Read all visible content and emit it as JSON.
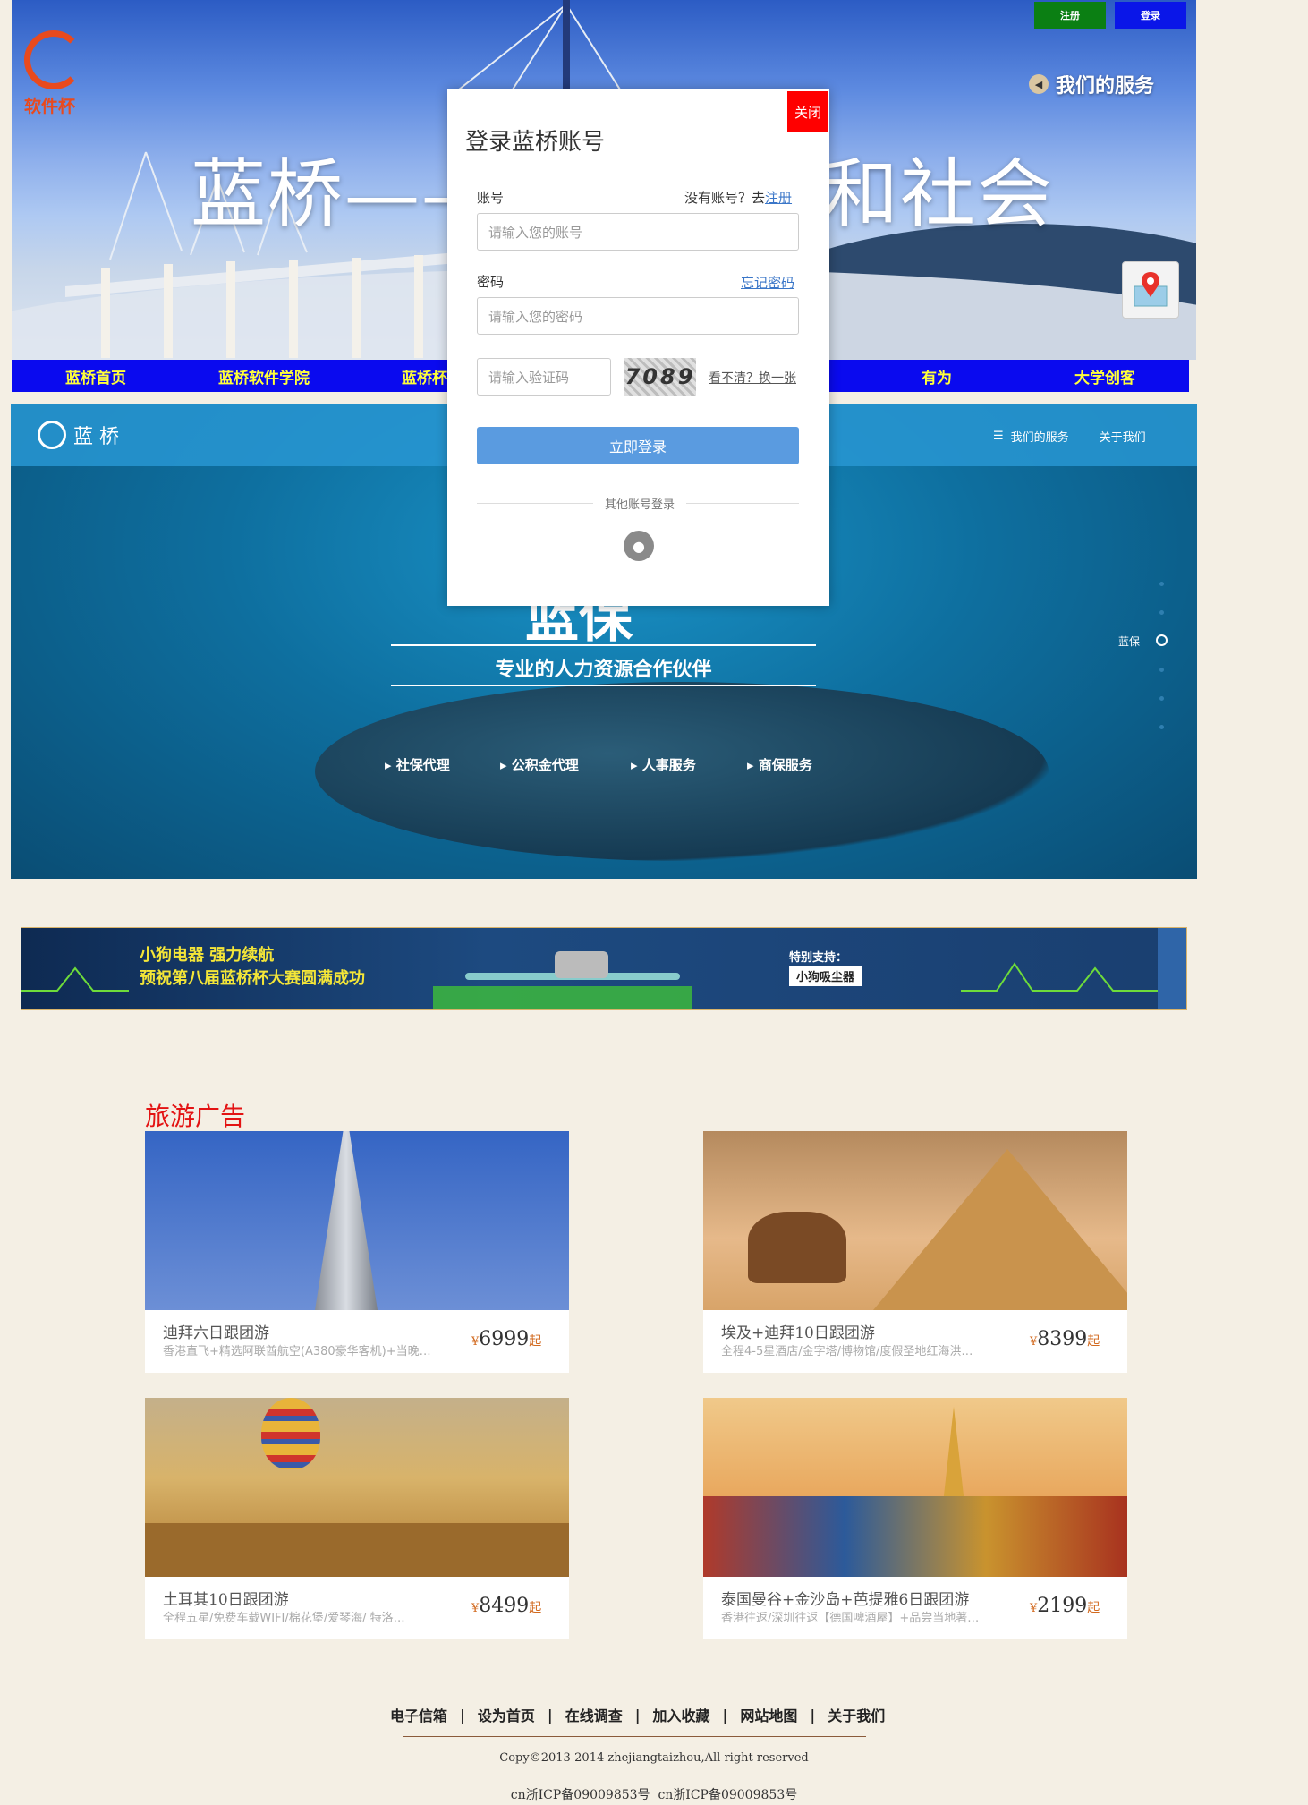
{
  "header": {
    "logo_text": "软件杯",
    "register_label": "注册",
    "login_label": "登录",
    "services_link": "我们的服务",
    "hero_title_left": "蓝桥——",
    "hero_title_right": "和社会"
  },
  "nav": {
    "items": [
      {
        "label": "蓝桥首页"
      },
      {
        "label": "蓝桥软件学院"
      },
      {
        "label": "蓝桥杯大"
      },
      {
        "label": ""
      },
      {
        "label": ""
      },
      {
        "label": "有为"
      },
      {
        "label": "大学创客"
      }
    ]
  },
  "ocean": {
    "brand": "蓝 桥",
    "menu_services": "我们的服务",
    "menu_about": "关于我们",
    "big_title": "蓝保",
    "subtitle": "专业的人力资源合作伙伴",
    "side_label": "蓝保",
    "services": [
      "社保代理",
      "公积金代理",
      "人事服务",
      "商保服务"
    ]
  },
  "modal": {
    "title": "登录蓝桥账号",
    "close_label": "关闭",
    "account_label": "账号",
    "no_account_text": "没有账号？去",
    "register_link": "注册",
    "account_placeholder": "请输入您的账号",
    "password_label": "密码",
    "forgot_link": "忘记密码",
    "password_placeholder": "请输入您的密码",
    "captcha_placeholder": "请输入验证码",
    "captcha_text": "7089",
    "refresh_link": "看不清？换一张",
    "submit_label": "立即登录",
    "other_login": "其他账号登录"
  },
  "banner": {
    "line1": "小狗电器 强力续航",
    "line2": "预祝第八届蓝桥杯大赛圆满成功",
    "support_label": "特别支持：",
    "sponsor": "小狗吸尘器"
  },
  "travel": {
    "section_title": "旅游广告",
    "cards": [
      {
        "title": "迪拜六日跟团游",
        "desc": "香港直飞+精选阿联酋航空(A380豪华客机)+当晚…",
        "yen": "¥",
        "price": "6999",
        "suffix": "起"
      },
      {
        "title": "埃及+迪拜10日跟团游",
        "desc": "全程4-5星酒店/金字塔/博物馆/度假圣地红海洪…",
        "yen": "¥",
        "price": "8399",
        "suffix": "起"
      },
      {
        "title": "土耳其10日跟团游",
        "desc": "全程五星/免费车载WIFI/棉花堡/爱琴海/ 特洛…",
        "yen": "¥",
        "price": "8499",
        "suffix": "起"
      },
      {
        "title": "泰国曼谷+金沙岛+芭提雅6日跟团游",
        "desc": "香港往返/深圳往返【德国啤酒屋】+品尝当地著…",
        "yen": "¥",
        "price": "2199",
        "suffix": "起"
      }
    ]
  },
  "footer": {
    "links": [
      "电子信箱",
      "设为首页",
      "在线调查",
      "加入收藏",
      "网站地图",
      "关于我们"
    ],
    "copyright": "Copy©2013-2014 zhejiangtaizhou,All right reserved",
    "icp": "cn浙ICP备09009853号  cn浙ICP备09009853号"
  }
}
